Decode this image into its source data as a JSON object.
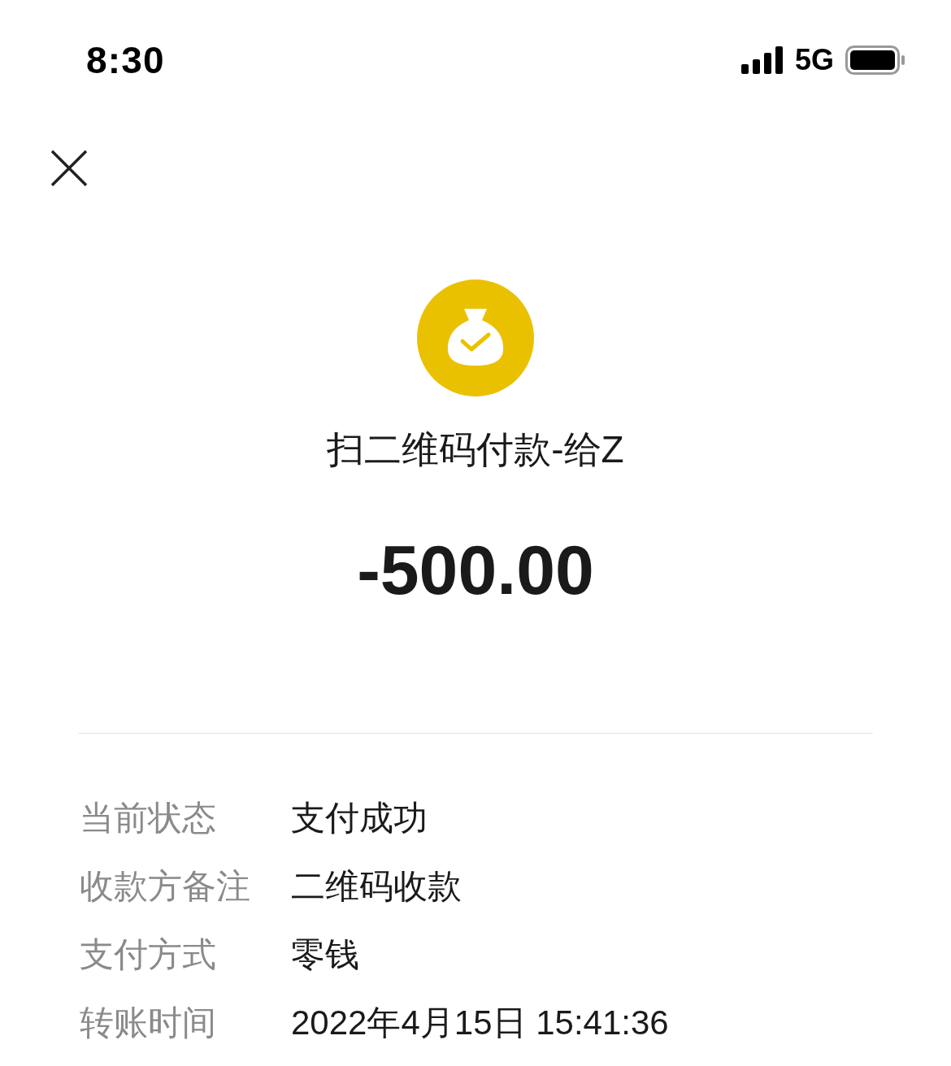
{
  "status_bar": {
    "time": "8:30",
    "network": "5G"
  },
  "title": "扫二维码付款-给Z",
  "amount": "-500.00",
  "details": [
    {
      "label": "当前状态",
      "value": "支付成功"
    },
    {
      "label": "收款方备注",
      "value": "二维码收款"
    },
    {
      "label": "支付方式",
      "value": "零钱"
    },
    {
      "label": "转账时间",
      "value": "2022年4月15日 15:41:36"
    }
  ]
}
